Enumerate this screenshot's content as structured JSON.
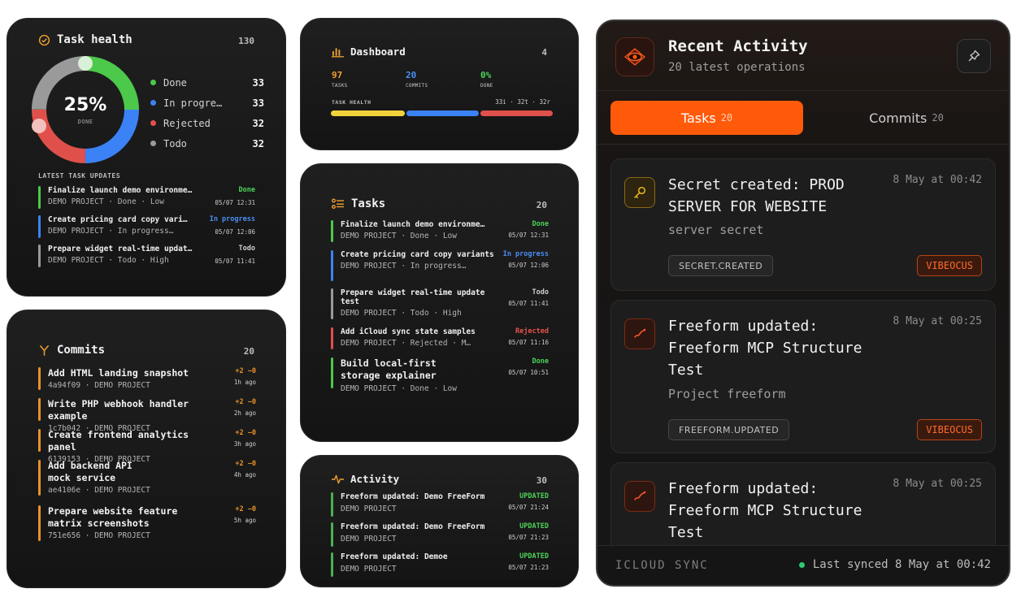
{
  "task_health": {
    "title": "Task health",
    "count": "130",
    "percent": "25%",
    "percent_label": "DONE",
    "legend": [
      {
        "label": "Done",
        "value": "33",
        "color": "#4cc84a"
      },
      {
        "label": "In progre…",
        "value": "33",
        "color": "#3b82f6"
      },
      {
        "label": "Rejected",
        "value": "32",
        "color": "#e0504a"
      },
      {
        "label": "Todo",
        "value": "32",
        "color": "#9a9a9a"
      }
    ],
    "section_label": "LATEST TASK UPDATES",
    "updates": [
      {
        "title": "Finalize launch demo environme…",
        "meta": "DEMO PROJECT · Done · Low",
        "status": "Done",
        "status_color": "#4cd25a",
        "bar_color": "#4cc84a",
        "time": "05/07 12:31"
      },
      {
        "title": "Create pricing card copy vari…",
        "meta": "DEMO PROJECT · In progress…",
        "status": "In progress",
        "status_color": "#4a8ef5",
        "bar_color": "#3b82f6",
        "time": "05/07 12:06"
      },
      {
        "title": "Prepare widget real-time updat…",
        "meta": "DEMO PROJECT · Todo · High",
        "status": "Todo",
        "status_color": "#cfcfcf",
        "bar_color": "#9a9a9a",
        "time": "05/07 11:41"
      }
    ]
  },
  "commits": {
    "title": "Commits",
    "count": "20",
    "items": [
      {
        "title": "Add HTML landing snapshot",
        "meta": "4a94f09 · DEMO PROJECT",
        "delta": "+2 −0",
        "ago": "1h ago"
      },
      {
        "title": "Write PHP webhook handler example",
        "meta": "1c7b042 · DEMO PROJECT",
        "delta": "+2 −0",
        "ago": "2h ago"
      },
      {
        "title": "Create frontend analytics panel",
        "meta": "6139153 · DEMO PROJECT",
        "delta": "+2 −0",
        "ago": "3h ago"
      },
      {
        "title": "Add backend API mock service",
        "meta": "ae4106e · DEMO PROJECT",
        "delta": "+2 −0",
        "ago": "4h ago"
      },
      {
        "title": "Prepare website feature matrix screenshots",
        "meta": "751e656 · DEMO PROJECT",
        "delta": "+2 −0",
        "ago": "5h ago"
      }
    ]
  },
  "dashboard": {
    "title": "Dashboard",
    "count": "4",
    "stats": [
      {
        "value": "97",
        "label": "TASKS",
        "color": "#f0a030"
      },
      {
        "value": "20",
        "label": "COMMITS",
        "color": "#4a8ef5"
      },
      {
        "value": "0%",
        "label": "DONE",
        "color": "#4cd25a"
      }
    ],
    "health_label": "TASK HEALTH",
    "health_summary": "33i · 32t · 32r",
    "bar_colors": [
      "#f2d23a",
      "#3b82f6",
      "#e0504a"
    ]
  },
  "tasks": {
    "title": "Tasks",
    "count": "20",
    "items": [
      {
        "title": "Finalize launch demo environme…",
        "meta": "DEMO PROJECT · Done · Low",
        "status": "Done",
        "status_color": "#4cd25a",
        "bar_color": "#4cc84a",
        "time": "05/07 12:31"
      },
      {
        "title": "Create pricing card copy variants",
        "meta": "DEMO PROJECT · In progress…",
        "status": "In progress",
        "status_color": "#4a8ef5",
        "bar_color": "#3b82f6",
        "time": "05/07 12:06"
      },
      {
        "title": "Prepare widget real-time update test",
        "meta": "DEMO PROJECT · Todo · High",
        "status": "Todo",
        "status_color": "#cfcfcf",
        "bar_color": "#9a9a9a",
        "time": "05/07 11:41"
      },
      {
        "title": "Add iCloud sync state samples",
        "meta": "DEMO PROJECT · Rejected · M…",
        "status": "Rejected",
        "status_color": "#e8534a",
        "bar_color": "#e0504a",
        "time": "05/07 11:16"
      },
      {
        "title": "Build local-first storage explainer",
        "meta": "DEMO PROJECT · Done · Low",
        "status": "Done",
        "status_color": "#4cd25a",
        "bar_color": "#4cc84a",
        "time": "05/07 10:51"
      }
    ]
  },
  "activity": {
    "title": "Activity",
    "count": "30",
    "items": [
      {
        "title": "Freeform updated: Demo FreeForm",
        "meta": "DEMO PROJECT",
        "status": "UPDATED",
        "time": "05/07 21:24"
      },
      {
        "title": "Freeform updated: Demo FreeForm",
        "meta": "DEMO PROJECT",
        "status": "UPDATED",
        "time": "05/07 21:23"
      },
      {
        "title": "Freeform updated: Demoe",
        "meta": "DEMO PROJECT",
        "status": "UPDATED",
        "time": "05/07 21:23"
      }
    ]
  },
  "recent_activity": {
    "title": "Recent Activity",
    "subtitle": "20 latest operations",
    "tabs": [
      {
        "label": "Tasks",
        "count": "20"
      },
      {
        "label": "Commits",
        "count": "20"
      }
    ],
    "cards": [
      {
        "title": "Secret created: PROD SERVER FOR WEBSITE",
        "time": "8 May at 00:42",
        "subtitle": "server secret",
        "tag": "SECRET.CREATED",
        "badge": "VIBEOCUS",
        "icon": "key-icon"
      },
      {
        "title": "Freeform updated: Freeform MCP Structure Test",
        "time": "8 May at 00:25",
        "subtitle": "Project freeform",
        "tag": "FREEFORM.UPDATED",
        "badge": "VIBEOCUS",
        "icon": "freeform-icon"
      },
      {
        "title": "Freeform updated: Freeform MCP Structure Test",
        "time": "8 May at 00:25",
        "subtitle": "",
        "tag": "",
        "badge": "",
        "icon": "freeform-icon"
      }
    ],
    "footer_left": "ICLOUD SYNC",
    "footer_right": "Last synced 8 May at 00:42"
  }
}
